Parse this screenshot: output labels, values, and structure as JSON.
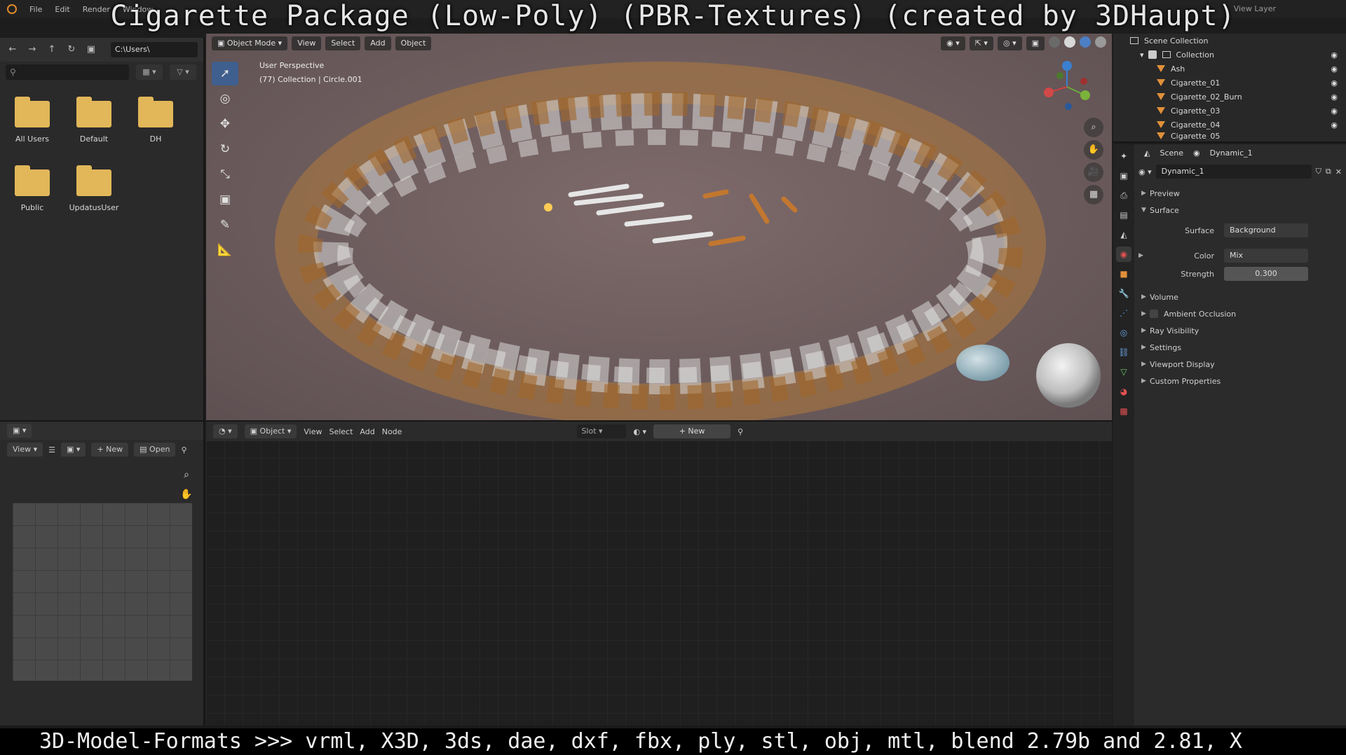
{
  "topbar": {
    "menu": [
      "File",
      "Edit",
      "Render",
      "Window"
    ],
    "view_layer": "View Layer"
  },
  "overlay": {
    "title": "Cigarette Package (Low-Poly) (PBR-Textures) (created by 3DHaupt)",
    "formats": "3D-Model-Formats >>> vrml, X3D, 3ds, dae, dxf, fbx, ply, stl, obj, mtl, blend 2.79b and 2.81, X"
  },
  "filebrowser": {
    "path": "C:\\Users\\",
    "search_placeholder": "",
    "folders": [
      "All Users",
      "Default",
      "DH",
      "Public",
      "UpdatusUser"
    ]
  },
  "imgeditor": {
    "view_label": "View",
    "new_label": "New",
    "open_label": "Open"
  },
  "viewport": {
    "mode": "Object Mode",
    "menu": [
      "View",
      "Select",
      "Add",
      "Object"
    ],
    "info_line1": "User Perspective",
    "info_line2": "(77) Collection | Circle.001"
  },
  "nodeeditor": {
    "mode": "Object",
    "menu": [
      "View",
      "Select",
      "Add",
      "Node"
    ],
    "slot": "Slot",
    "new_label": "New"
  },
  "outliner": {
    "root": "Scene Collection",
    "collection": "Collection",
    "items": [
      "Ash",
      "Cigarette_01",
      "Cigarette_02_Burn",
      "Cigarette_03",
      "Cigarette_04",
      "Cigarette_05"
    ]
  },
  "properties": {
    "scene_label": "Scene",
    "world_label": "Dynamic_1",
    "datablock": "Dynamic_1",
    "panels": {
      "preview": "Preview",
      "surface": "Surface"
    },
    "surface_label": "Surface",
    "surface_value": "Background",
    "color_label": "Color",
    "color_value": "Mix",
    "strength_label": "Strength",
    "strength_value": "0.300",
    "sub_panels": [
      "Volume",
      "Ambient Occlusion",
      "Ray Visibility",
      "Settings",
      "Viewport Display",
      "Custom Properties"
    ]
  },
  "colors": {
    "accent_orange": "#e0903a",
    "active_blue": "#3f5f8f",
    "folder": "#e2b75a"
  }
}
